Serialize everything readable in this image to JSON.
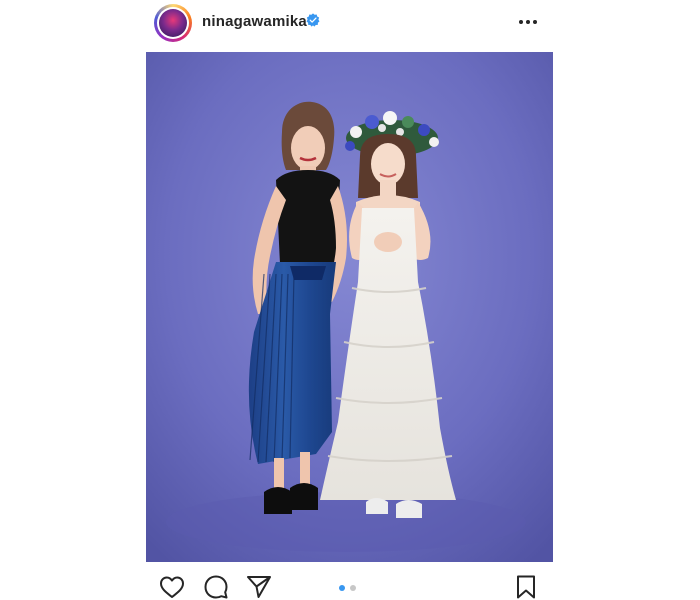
{
  "post": {
    "username": "ninagawamika",
    "verified": true,
    "avatar": "profile-avatar",
    "more_icon": "more-horizontal-icon",
    "photo": {
      "description_icon": "photo",
      "background_color": "#6a6cbf"
    },
    "actions": {
      "like_icon": "heart-icon",
      "comment_icon": "comment-icon",
      "share_icon": "send-icon",
      "save_icon": "bookmark-icon"
    },
    "carousel": {
      "total": 2,
      "active": 1,
      "active_color": "#3897f0",
      "inactive_color": "#c7c7c7"
    }
  }
}
